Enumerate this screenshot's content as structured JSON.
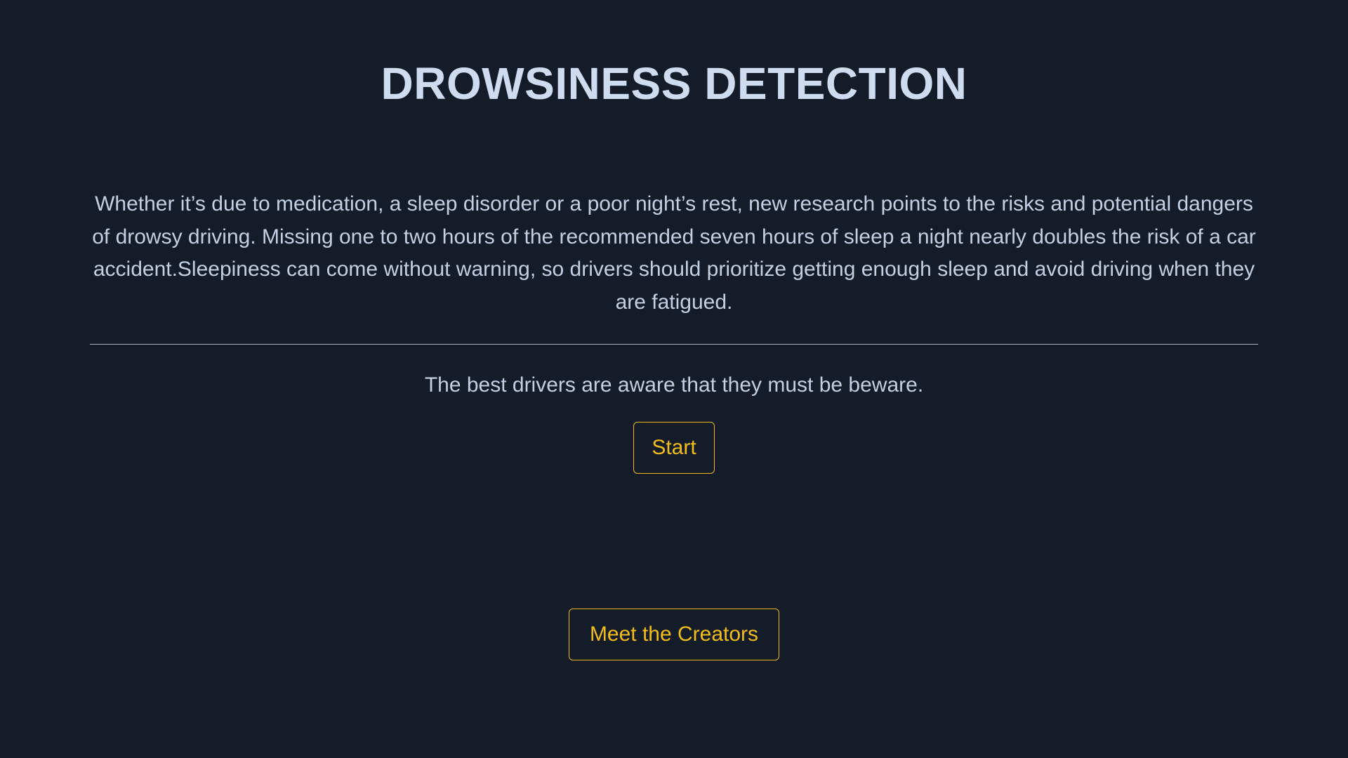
{
  "header": {
    "title": "DROWSINESS DETECTION"
  },
  "main": {
    "intro": "Whether it’s due to medication, a sleep disorder or a poor night’s rest, new research points to the risks and potential dangers of drowsy driving. Missing one to two hours of the recommended seven hours of sleep a night nearly doubles the risk of a car accident.Sleepiness can come without warning, so drivers should prioritize getting enough sleep and avoid driving when they are fatigued.",
    "tagline": "The best drivers are aware that they must be beware.",
    "start_label": "Start",
    "creators_label": "Meet the Creators"
  },
  "colors": {
    "background": "#131c28",
    "text": "#c3cfe2",
    "accent": "#f2bc1c"
  }
}
